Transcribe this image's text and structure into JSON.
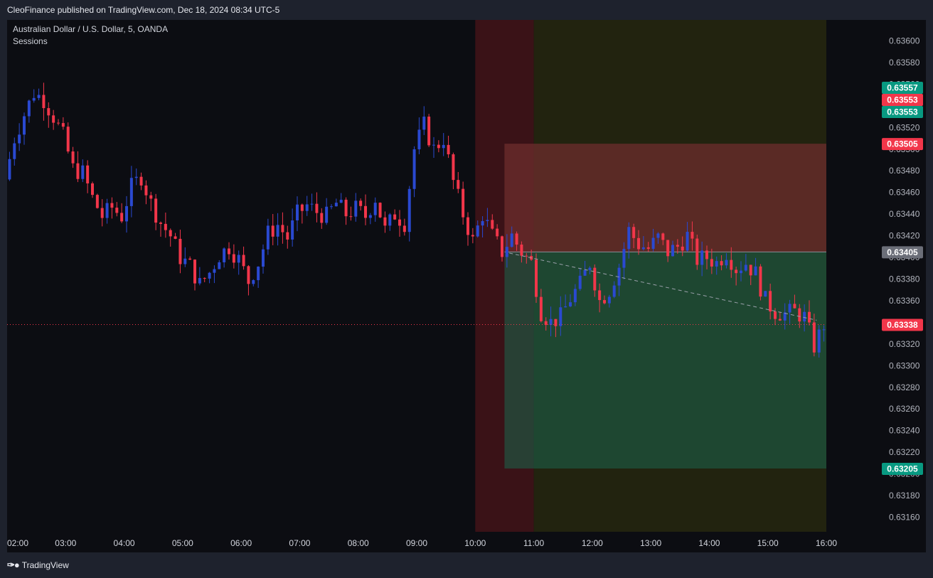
{
  "header": {
    "publish_line": "CleoFinance published on TradingView.com, Dec 18, 2024 08:34 UTC-5"
  },
  "footer": {
    "brand": "TradingView"
  },
  "chart_data": {
    "type": "candlestick",
    "symbol_title": "Australian Dollar / U.S. Dollar, 5, OANDA",
    "indicator": "Sessions",
    "time_ticks": [
      "02:00",
      "03:00",
      "04:00",
      "05:00",
      "06:00",
      "07:00",
      "08:00",
      "09:00",
      "10:00",
      "11:00",
      "12:00",
      "13:00",
      "14:00",
      "15:00",
      "16:00"
    ],
    "y_ticks": [
      "0.63600",
      "0.63580",
      "0.63560",
      "0.63540",
      "0.63520",
      "0.63500",
      "0.63480",
      "0.63460",
      "0.63440",
      "0.63420",
      "0.63400",
      "0.63380",
      "0.63360",
      "0.63340",
      "0.63320",
      "0.63300",
      "0.63280",
      "0.63260",
      "0.63240",
      "0.63220",
      "0.63200",
      "0.63180",
      "0.63160"
    ],
    "ylim": [
      0.6315,
      0.6362
    ],
    "colors": {
      "up": "#2a49d1",
      "down": "#f2364a",
      "background": "#0c0d12",
      "session_a": "#451317",
      "session_b": "#2a2a12",
      "stop_zone": "#6e2d2e",
      "target_zone": "#1c5f47",
      "current_line": "#f2364a"
    },
    "sessions": [
      {
        "start": "10:00",
        "end": "11:00",
        "color": "#3a1217"
      },
      {
        "start": "11:00",
        "end": "16:00",
        "color": "#22230f"
      }
    ],
    "position": {
      "start": "10:30",
      "end": "16:00",
      "entry": 0.63405,
      "stop": 0.63505,
      "target": 0.63205
    },
    "trend_line": {
      "from_time": "10:35",
      "from_price": 0.63404,
      "to_time": "15:50",
      "to_price": 0.63342
    },
    "current_price": 0.63338,
    "price_labels": [
      {
        "text": "0.63557",
        "value": 0.63557,
        "color": "#089981"
      },
      {
        "text": "0.63553",
        "value": 0.63553,
        "color": "#f2364a"
      },
      {
        "text": "0.63553",
        "value": 0.63553,
        "color": "#089981"
      },
      {
        "text": "0.63505",
        "value": 0.63505,
        "color": "#f2364a"
      },
      {
        "text": "0.63405",
        "value": 0.63405,
        "color": "#6b6e78"
      },
      {
        "text": "0.63338",
        "value": 0.63338,
        "color": "#f2364a"
      },
      {
        "text": "0.63205",
        "value": 0.63205,
        "color": "#089981"
      }
    ],
    "close_path": [
      [
        "02:00",
        0.63472
      ],
      [
        "02:10",
        0.6351
      ],
      [
        "02:20",
        0.63532
      ],
      [
        "02:30",
        0.63552
      ],
      [
        "02:40",
        0.63546
      ],
      [
        "02:50",
        0.6353
      ],
      [
        "03:00",
        0.63512
      ],
      [
        "03:10",
        0.63482
      ],
      [
        "03:20",
        0.63478
      ],
      [
        "03:30",
        0.63455
      ],
      [
        "03:40",
        0.63438
      ],
      [
        "03:50",
        0.63446
      ],
      [
        "04:00",
        0.63438
      ],
      [
        "04:10",
        0.63465
      ],
      [
        "04:20",
        0.63475
      ],
      [
        "04:30",
        0.6345
      ],
      [
        "04:40",
        0.63432
      ],
      [
        "04:50",
        0.6342
      ],
      [
        "05:00",
        0.634
      ],
      [
        "05:10",
        0.63392
      ],
      [
        "05:20",
        0.63375
      ],
      [
        "05:30",
        0.63386
      ],
      [
        "05:40",
        0.63402
      ],
      [
        "05:50",
        0.6341
      ],
      [
        "06:00",
        0.63398
      ],
      [
        "06:10",
        0.63378
      ],
      [
        "06:20",
        0.63395
      ],
      [
        "06:30",
        0.63422
      ],
      [
        "06:40",
        0.6343
      ],
      [
        "06:50",
        0.63418
      ],
      [
        "07:00",
        0.6344
      ],
      [
        "07:10",
        0.63448
      ],
      [
        "07:20",
        0.63442
      ],
      [
        "07:30",
        0.63438
      ],
      [
        "07:40",
        0.6345
      ],
      [
        "07:50",
        0.6344
      ],
      [
        "08:00",
        0.63445
      ],
      [
        "08:10",
        0.63438
      ],
      [
        "08:20",
        0.63455
      ],
      [
        "08:30",
        0.63425
      ],
      [
        "08:40",
        0.6344
      ],
      [
        "08:50",
        0.63432
      ],
      [
        "09:00",
        0.635
      ],
      [
        "09:10",
        0.63522
      ],
      [
        "09:20",
        0.635
      ],
      [
        "09:30",
        0.6351
      ],
      [
        "09:40",
        0.6347
      ],
      [
        "09:50",
        0.6344
      ],
      [
        "10:00",
        0.63415
      ],
      [
        "10:10",
        0.6344
      ],
      [
        "10:20",
        0.6342
      ],
      [
        "10:30",
        0.63405
      ],
      [
        "10:40",
        0.6342
      ],
      [
        "10:50",
        0.63405
      ],
      [
        "11:00",
        0.63395
      ],
      [
        "11:10",
        0.6335
      ],
      [
        "11:20",
        0.6334
      ],
      [
        "11:30",
        0.63345
      ],
      [
        "11:40",
        0.63362
      ],
      [
        "11:50",
        0.63375
      ],
      [
        "12:00",
        0.63395
      ],
      [
        "12:10",
        0.6336
      ],
      [
        "12:20",
        0.6337
      ],
      [
        "12:30",
        0.63392
      ],
      [
        "12:40",
        0.63425
      ],
      [
        "12:50",
        0.63412
      ],
      [
        "13:00",
        0.63408
      ],
      [
        "13:10",
        0.63418
      ],
      [
        "13:20",
        0.63405
      ],
      [
        "13:30",
        0.6341
      ],
      [
        "13:40",
        0.6342
      ],
      [
        "13:50",
        0.63398
      ],
      [
        "14:00",
        0.634
      ],
      [
        "14:10",
        0.63395
      ],
      [
        "14:20",
        0.63405
      ],
      [
        "14:30",
        0.6339
      ],
      [
        "14:40",
        0.63395
      ],
      [
        "14:50",
        0.63385
      ],
      [
        "15:00",
        0.6336
      ],
      [
        "15:10",
        0.6335
      ],
      [
        "15:20",
        0.63348
      ],
      [
        "15:30",
        0.6335
      ],
      [
        "15:40",
        0.63345
      ],
      [
        "15:50",
        0.63318
      ],
      [
        "16:00",
        0.63338
      ]
    ]
  }
}
